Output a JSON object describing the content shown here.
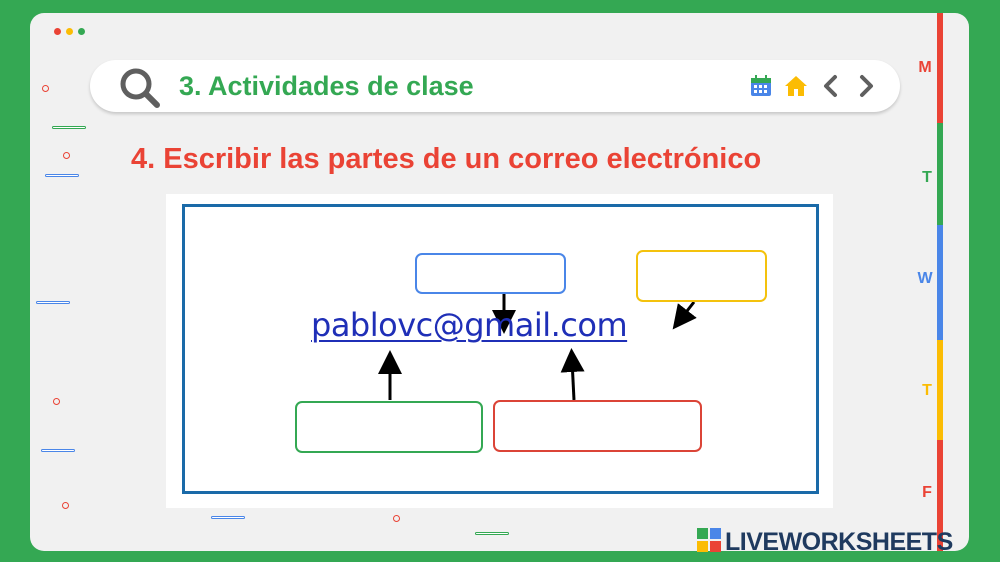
{
  "window": {
    "dot_colors": [
      "#ea4335",
      "#fbbc04",
      "#34a853"
    ]
  },
  "searchbar": {
    "title": "3. Actividades de clase",
    "icons": [
      "search-icon",
      "calendar-icon",
      "home-icon",
      "chevron-left-icon",
      "chevron-right-icon"
    ]
  },
  "activity": {
    "heading": "4. Escribir las partes de un correo electrónico",
    "email": "pablovc@gmail.com",
    "answer_boxes": [
      {
        "id": "box-blue",
        "color": "#4a86e8",
        "value": ""
      },
      {
        "id": "box-yellow",
        "color": "#f4c20d",
        "value": ""
      },
      {
        "id": "box-green",
        "color": "#34a853",
        "value": ""
      },
      {
        "id": "box-red",
        "color": "#db4437",
        "value": ""
      }
    ]
  },
  "week_tabs": [
    {
      "label": "M",
      "color": "#ea4335"
    },
    {
      "label": "T",
      "color": "#34a853"
    },
    {
      "label": "W",
      "color": "#4a86e8"
    },
    {
      "label": "T",
      "color": "#fbbc04"
    },
    {
      "label": "F",
      "color": "#ea4335"
    }
  ],
  "brand": {
    "name": "LIVEWORKSHEETS"
  },
  "colors": {
    "background": "#34a853",
    "card": "#f1f1f1",
    "title_green": "#34a853",
    "heading_red": "#ea4335",
    "frame_blue": "#1a6aa8",
    "link_blue": "#1f2fb7"
  }
}
